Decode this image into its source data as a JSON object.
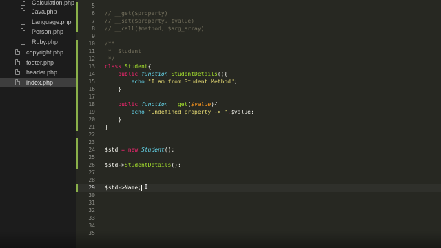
{
  "sidebar": {
    "files": [
      {
        "name": "Calculation.php",
        "active": false
      },
      {
        "name": "Java.php",
        "active": false
      },
      {
        "name": "Language.php",
        "active": false
      },
      {
        "name": "Person.php",
        "active": false
      },
      {
        "name": "Ruby.php",
        "active": false
      },
      {
        "name": "copyright.php",
        "active": false
      },
      {
        "name": "footer.php",
        "active": false
      },
      {
        "name": "header.php",
        "active": false
      },
      {
        "name": "index.php",
        "active": true
      }
    ]
  },
  "editor": {
    "current_line": 29,
    "lines": [
      {
        "n": "5",
        "tokens": []
      },
      {
        "n": "6",
        "tokens": [
          {
            "t": "c",
            "v": "// __get($property)"
          }
        ]
      },
      {
        "n": "7",
        "tokens": [
          {
            "t": "c",
            "v": "// __set($property, $value)"
          }
        ]
      },
      {
        "n": "8",
        "tokens": [
          {
            "t": "c",
            "v": "// __call($method, $arg_array)"
          }
        ]
      },
      {
        "n": "9",
        "tokens": []
      },
      {
        "n": "10",
        "tokens": [
          {
            "t": "c",
            "v": "/**"
          }
        ]
      },
      {
        "n": "11",
        "tokens": [
          {
            "t": "c",
            "v": " *  Student"
          }
        ]
      },
      {
        "n": "12",
        "tokens": [
          {
            "t": "c",
            "v": " */"
          }
        ]
      },
      {
        "n": "13",
        "tokens": [
          {
            "t": "k",
            "v": "class "
          },
          {
            "t": "f",
            "v": "Student"
          },
          {
            "t": "w",
            "v": "{"
          }
        ]
      },
      {
        "n": "14",
        "tokens": [
          {
            "t": "w",
            "v": "    "
          },
          {
            "t": "k",
            "v": "public "
          },
          {
            "t": "st",
            "v": "function "
          },
          {
            "t": "f",
            "v": "StudentDetails"
          },
          {
            "t": "w",
            "v": "(){"
          }
        ]
      },
      {
        "n": "15",
        "tokens": [
          {
            "t": "w",
            "v": "        "
          },
          {
            "t": "bk",
            "v": "echo "
          },
          {
            "t": "s",
            "v": "\"I am from Student Method\""
          },
          {
            "t": "w",
            "v": ";"
          }
        ]
      },
      {
        "n": "16",
        "tokens": [
          {
            "t": "w",
            "v": "    }"
          }
        ]
      },
      {
        "n": "17",
        "tokens": []
      },
      {
        "n": "18",
        "tokens": [
          {
            "t": "w",
            "v": "    "
          },
          {
            "t": "k",
            "v": "public "
          },
          {
            "t": "st",
            "v": "function "
          },
          {
            "t": "f",
            "v": "__get"
          },
          {
            "t": "w",
            "v": "("
          },
          {
            "t": "v",
            "v": "$value"
          },
          {
            "t": "w",
            "v": "){"
          }
        ]
      },
      {
        "n": "19",
        "tokens": [
          {
            "t": "w",
            "v": "        "
          },
          {
            "t": "bk",
            "v": "echo "
          },
          {
            "t": "s",
            "v": "\"Undefined property -> \""
          },
          {
            "t": "k",
            "v": "."
          },
          {
            "t": "w",
            "v": "$value;"
          }
        ]
      },
      {
        "n": "20",
        "tokens": [
          {
            "t": "w",
            "v": "    }"
          }
        ]
      },
      {
        "n": "21",
        "tokens": [
          {
            "t": "w",
            "v": "}"
          }
        ]
      },
      {
        "n": "22",
        "tokens": []
      },
      {
        "n": "23",
        "tokens": []
      },
      {
        "n": "24",
        "tokens": [
          {
            "t": "w",
            "v": "$std "
          },
          {
            "t": "k",
            "v": "= new "
          },
          {
            "t": "st",
            "v": "Student"
          },
          {
            "t": "w",
            "v": "();"
          }
        ]
      },
      {
        "n": "25",
        "tokens": []
      },
      {
        "n": "26",
        "tokens": [
          {
            "t": "w",
            "v": "$std->"
          },
          {
            "t": "fn",
            "v": "StudentDetails"
          },
          {
            "t": "w",
            "v": "();"
          }
        ]
      },
      {
        "n": "27",
        "tokens": []
      },
      {
        "n": "28",
        "tokens": []
      },
      {
        "n": "29",
        "tokens": [
          {
            "t": "w",
            "v": "$std->Name;"
          }
        ]
      },
      {
        "n": "30",
        "tokens": []
      },
      {
        "n": "31",
        "tokens": []
      },
      {
        "n": "32",
        "tokens": []
      },
      {
        "n": "33",
        "tokens": []
      },
      {
        "n": "34",
        "tokens": []
      },
      {
        "n": "35",
        "tokens": []
      }
    ]
  },
  "colors": {
    "background": "#272822",
    "sidebar": "#1c1c1c",
    "comment": "#75715e",
    "keyword": "#f92672",
    "string": "#e6db74",
    "function": "#a6e22e",
    "storage": "#66d9ef",
    "param": "#fd971f",
    "modified_marker": "#8ab04a"
  },
  "icons": {
    "file": "file-icon",
    "cursor": "text-cursor-icon"
  }
}
